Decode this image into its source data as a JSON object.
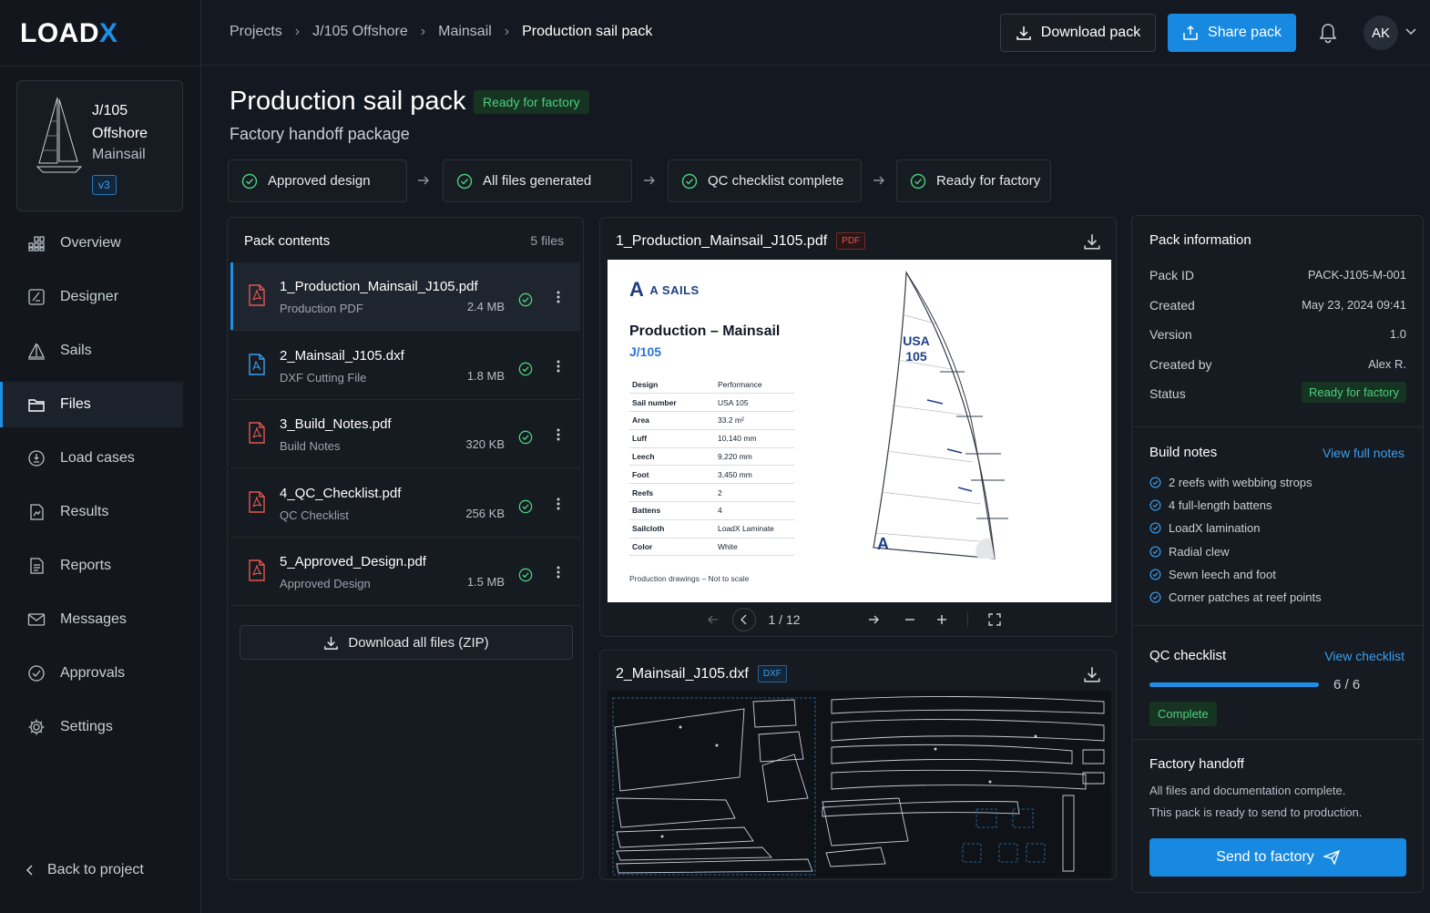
{
  "app": {
    "logo_main": "LOAD",
    "logo_accent": "X"
  },
  "project": {
    "name": "J/105 Offshore",
    "sail": "Mainsail",
    "version": "v3"
  },
  "nav": [
    {
      "label": "Overview",
      "icon": "grid-icon"
    },
    {
      "label": "Designer",
      "icon": "designer-icon"
    },
    {
      "label": "Sails",
      "icon": "sail-icon"
    },
    {
      "label": "Files",
      "icon": "folder-icon",
      "active": true
    },
    {
      "label": "Load cases",
      "icon": "load-icon"
    },
    {
      "label": "Results",
      "icon": "results-icon"
    },
    {
      "label": "Reports",
      "icon": "report-icon"
    },
    {
      "label": "Messages",
      "icon": "mail-icon"
    },
    {
      "label": "Approvals",
      "icon": "approval-icon"
    },
    {
      "label": "Settings",
      "icon": "gear-icon"
    }
  ],
  "back_label": "Back to project",
  "breadcrumbs": [
    "Projects",
    "J/105 Offshore",
    "Mainsail",
    "Production sail pack"
  ],
  "topbar": {
    "download_label": "Download pack",
    "share_label": "Share pack",
    "avatar": "AK"
  },
  "header": {
    "title": "Production sail pack",
    "status": "Ready for factory",
    "subtitle": "Factory handoff package"
  },
  "steps": [
    "Approved design",
    "All files generated",
    "QC checklist complete",
    "Ready for factory"
  ],
  "pack": {
    "title": "Pack contents",
    "count": "5 files",
    "files": [
      {
        "name": "1_Production_Mainsail_J105.pdf",
        "type": "Production PDF",
        "size": "2.4 MB",
        "kind": "pdf"
      },
      {
        "name": "2_Mainsail_J105.dxf",
        "type": "DXF Cutting File",
        "size": "1.8 MB",
        "kind": "dxf"
      },
      {
        "name": "3_Build_Notes.pdf",
        "type": "Build Notes",
        "size": "320 KB",
        "kind": "pdf"
      },
      {
        "name": "4_QC_Checklist.pdf",
        "type": "QC Checklist",
        "size": "256 KB",
        "kind": "pdf"
      },
      {
        "name": "5_Approved_Design.pdf",
        "type": "Approved Design",
        "size": "1.5 MB",
        "kind": "pdf"
      }
    ],
    "zip_label": "Download all files (ZIP)"
  },
  "pdf_viewer": {
    "filename": "1_Production_Mainsail_J105.pdf",
    "tag": "PDF",
    "brand": "A SAILS",
    "brand_mark": "A",
    "doc_title": "Production – Mainsail",
    "doc_subtitle": "J/105",
    "sail_number_text": [
      "USA",
      "105"
    ],
    "specs": [
      [
        "Design",
        "Performance"
      ],
      [
        "Sail number",
        "USA 105"
      ],
      [
        "Area",
        "33.2 m²"
      ],
      [
        "Luff",
        "10,140 mm"
      ],
      [
        "Leech",
        "9,220 mm"
      ],
      [
        "Foot",
        "3,450 mm"
      ],
      [
        "Reefs",
        "2"
      ],
      [
        "Battens",
        "4"
      ],
      [
        "Sailcloth",
        "LoadX Laminate"
      ],
      [
        "Color",
        "White"
      ]
    ],
    "footnote": "Production drawings – Not to scale",
    "page": "1 / 12"
  },
  "dxf_viewer": {
    "filename": "2_Mainsail_J105.dxf",
    "tag": "DXF"
  },
  "info": {
    "title": "Pack information",
    "rows": [
      {
        "label": "Pack ID",
        "value": "PACK-J105-M-001"
      },
      {
        "label": "Created",
        "value": "May 23, 2024 09:41"
      },
      {
        "label": "Version",
        "value": "1.0"
      },
      {
        "label": "Created by",
        "value": "Alex R."
      },
      {
        "label": "Status",
        "value": "Ready for factory"
      }
    ]
  },
  "build_notes": {
    "title": "Build notes",
    "link": "View full notes",
    "items": [
      "2 reefs with webbing strops",
      "4 full-length battens",
      "LoadX lamination",
      "Radial clew",
      "Sewn leech and foot",
      "Corner patches at reef points"
    ]
  },
  "qc": {
    "title": "QC checklist",
    "link": "View checklist",
    "count": "6 / 6",
    "progress": 1.0,
    "status": "Complete"
  },
  "handoff": {
    "title": "Factory handoff",
    "line1": "All files and documentation complete.",
    "line2": "This pack is ready to send to production.",
    "button": "Send to factory"
  },
  "colors": {
    "accent": "#1789e0",
    "success": "#4ccf7d",
    "pdf_red": "#e4564d",
    "background": "#141820"
  }
}
